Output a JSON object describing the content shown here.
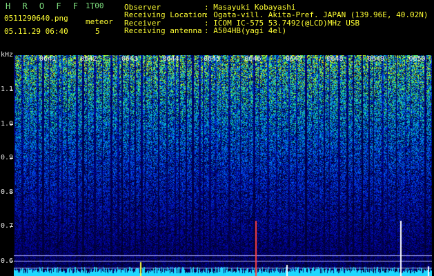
{
  "header": {
    "brand": "H R O F F T",
    "version": "1.00",
    "filename": "0511290640.png",
    "meteor_label": "meteor",
    "meteor_count": "5",
    "datetime": "05.11.29 06:40"
  },
  "info": {
    "observer_key": "Observer",
    "observer_val": ": Masayuki Kobayashi",
    "location_key": "Receiving Location",
    "location_val": ": Ogata-vill. Akita-Pref. JAPAN (139.96E, 40.02N)",
    "receiver_key": "Receiver",
    "receiver_val": ": ICOM IC-575 53.7492(@LCD)MHz USB",
    "antenna_key": "Receiving antenna",
    "antenna_val": ": A504HB(yagi 4el)"
  },
  "axis": {
    "unit": "kHz",
    "ticks": [
      "1.1",
      "1.0",
      "0.9",
      "0.8",
      "0.7",
      "0.6"
    ]
  },
  "times": [
    "0641",
    "0642",
    "0643",
    "0644",
    "0645",
    "0646",
    "0647",
    "0648",
    "0649",
    "0650"
  ],
  "colors": {
    "bg": "#000000",
    "header_text": "#ffff33",
    "brand_text": "#7fe07f",
    "axis_text": "#e6e6e6"
  }
}
